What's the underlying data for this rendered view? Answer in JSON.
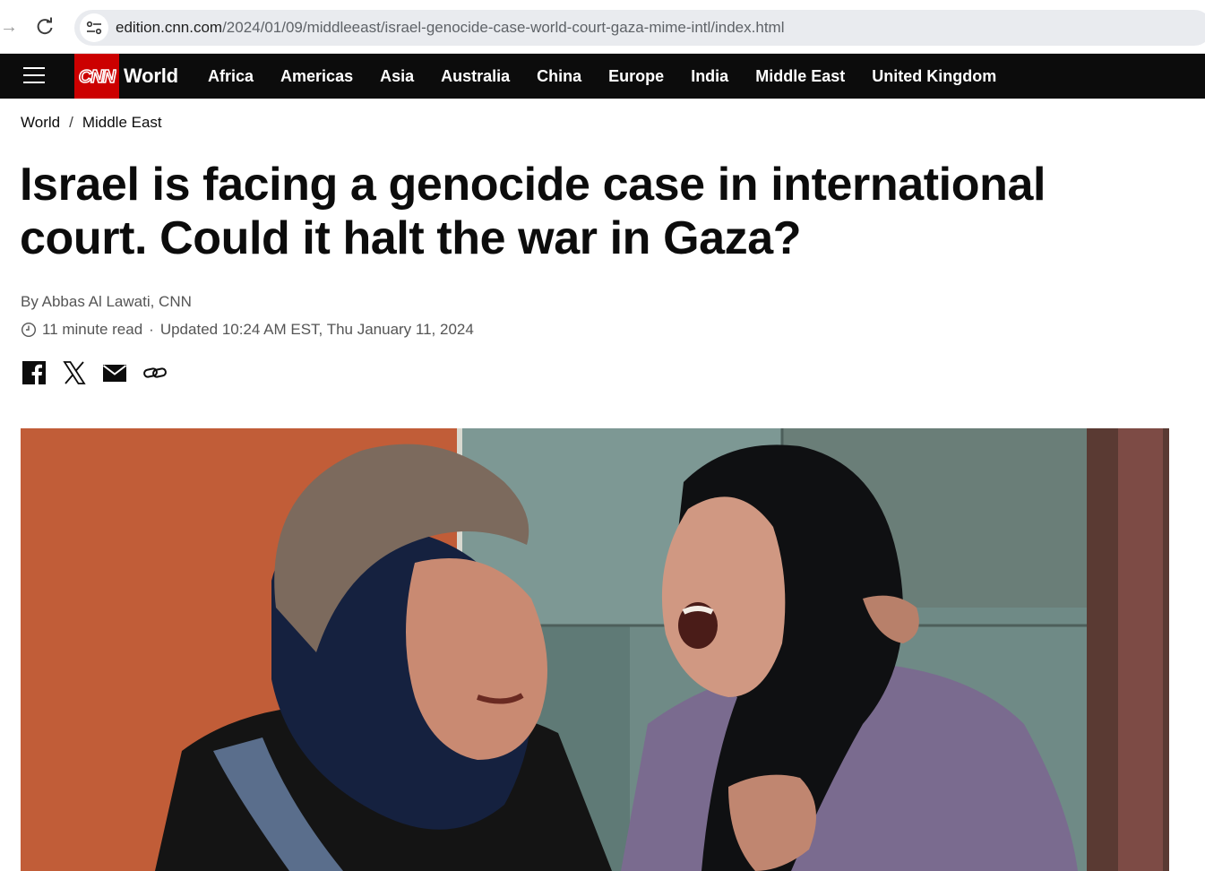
{
  "browser": {
    "url_host": "edition.cnn.com",
    "url_path": "/2024/01/09/middleeast/israel-genocide-case-world-court-gaza-mime-intl/index.html"
  },
  "navbar": {
    "logo_text": "CNN",
    "section": "World",
    "items": [
      "Africa",
      "Americas",
      "Asia",
      "Australia",
      "China",
      "Europe",
      "India",
      "Middle East",
      "United Kingdom"
    ]
  },
  "breadcrumb": {
    "items": [
      "World",
      "Middle East"
    ],
    "separator": "/"
  },
  "article": {
    "headline": "Israel is facing a genocide case in international court. Could it halt the war in Gaza?",
    "byline_prefix": "By ",
    "author": "Abbas Al Lawati, CNN",
    "read_time": "11 minute read",
    "updated": "Updated 10:24 AM EST, Thu January 11, 2024"
  },
  "share": {
    "icons": [
      "facebook-icon",
      "x-icon",
      "email-icon",
      "link-icon"
    ]
  },
  "colors": {
    "brand_red": "#cc0000",
    "nav_bg": "#0c0c0c",
    "meta_text": "#555555"
  }
}
